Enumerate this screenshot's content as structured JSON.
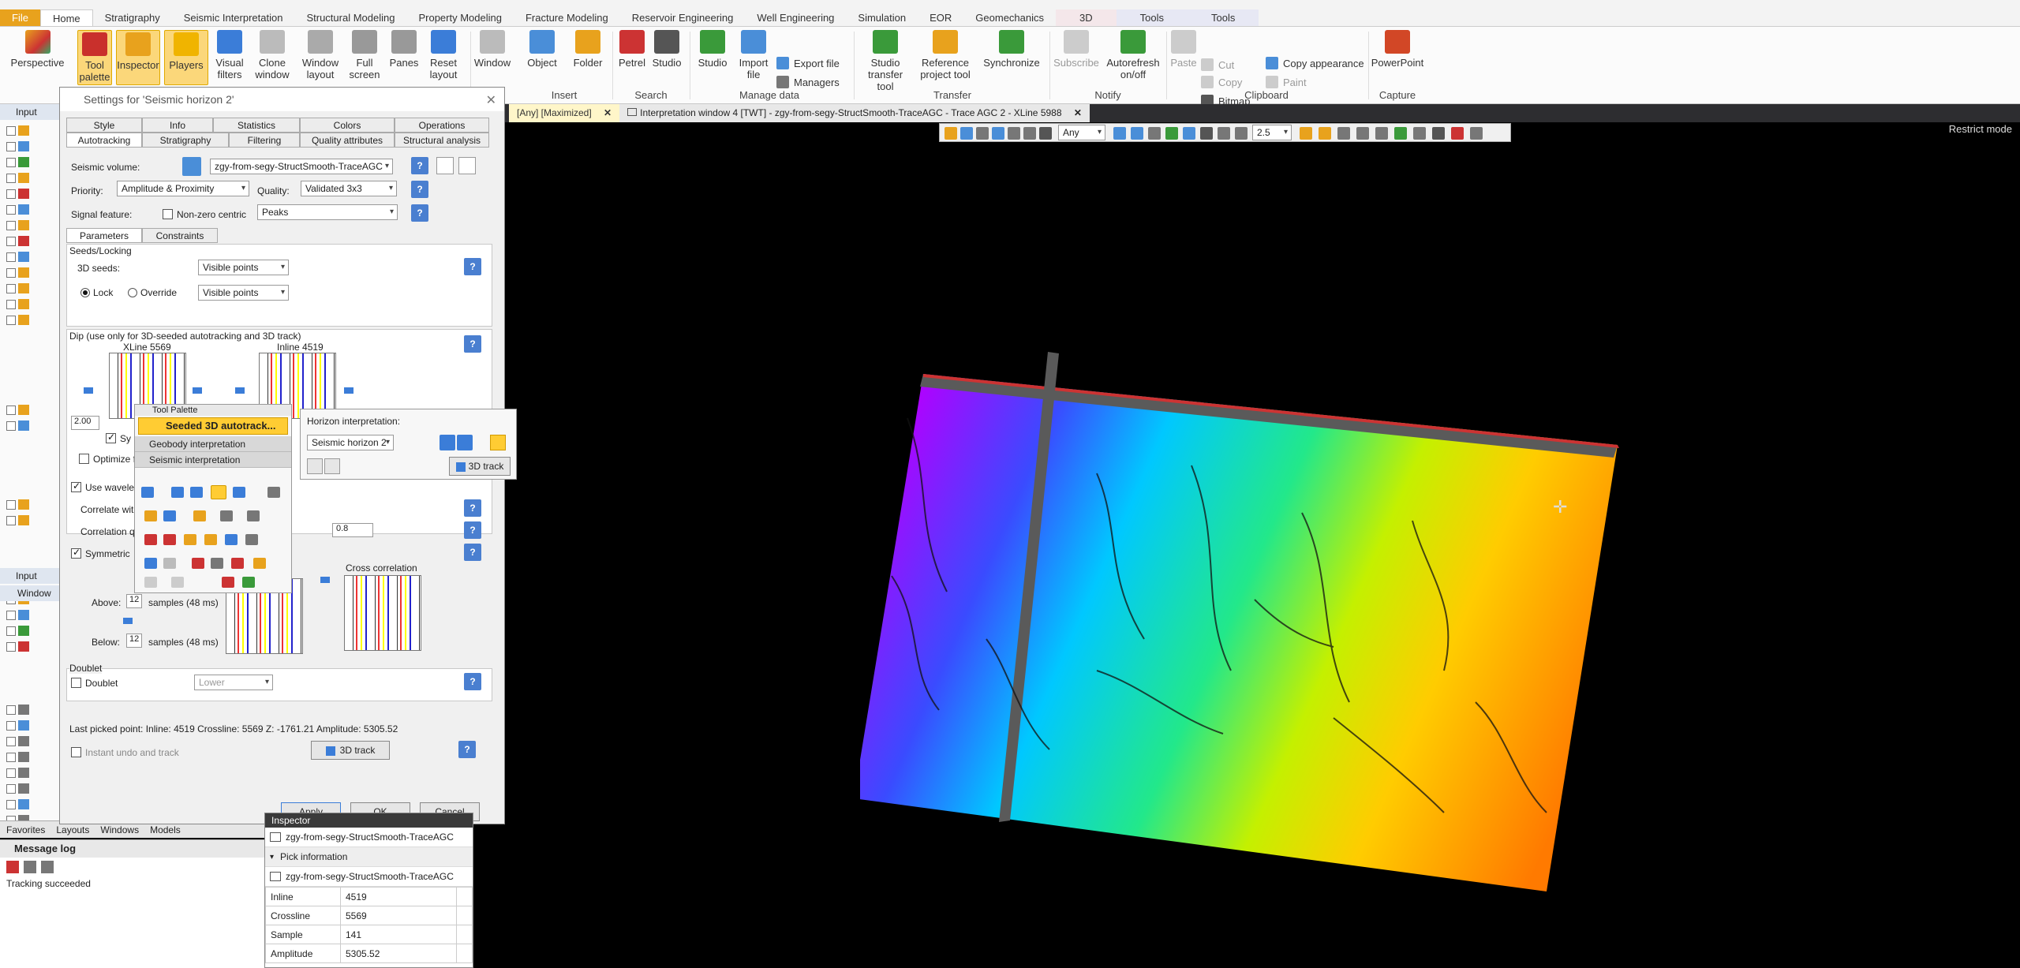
{
  "ribbon": {
    "tabs": [
      "File",
      "Home",
      "Stratigraphy",
      "Seismic Interpretation",
      "Structural Modeling",
      "Property Modeling",
      "Fracture Modeling",
      "Reservoir Engineering",
      "Well Engineering",
      "Simulation",
      "EOR",
      "Geomechanics",
      "3D",
      "Tools",
      "Tools"
    ],
    "buttons": {
      "perspective": "Perspective",
      "tool_palette": "Tool palette",
      "inspector": "Inspector",
      "players": "Players",
      "visual_filters": "Visual filters",
      "clone_window": "Clone window",
      "window_layout": "Window layout",
      "full_screen": "Full screen",
      "panes": "Panes",
      "reset_layout": "Reset layout",
      "window": "Window",
      "object": "Object",
      "folder": "Folder",
      "petrel": "Petrel",
      "studio": "Studio",
      "studio2": "Studio",
      "import_file": "Import file",
      "export_file": "Export file",
      "managers": "Managers",
      "studio_transfer": "Studio transfer tool",
      "reference_project": "Reference project tool",
      "synchronize": "Synchronize",
      "subscribe": "Subscribe",
      "autorefresh": "Autorefresh on/off",
      "paste": "Paste",
      "cut": "Cut",
      "copy": "Copy",
      "bitmap": "Bitmap",
      "copy_appearance": "Copy appearance",
      "paint": "Paint",
      "powerpoint": "PowerPoint"
    },
    "groups": {
      "insert": "Insert",
      "search": "Search",
      "manage": "Manage data",
      "transfer": "Transfer",
      "notify": "Notify",
      "clipboard": "Clipboard",
      "capture": "Capture"
    }
  },
  "doc_tabs": {
    "tab1": "[Any] [Maximized]",
    "tab2": "Interpretation window 4 [TWT] - zgy-from-segy-StructSmooth-TraceAGC - Trace AGC 2 - XLine 5988"
  },
  "view_toolbar": {
    "domain": "Any",
    "value": "2.5"
  },
  "restrict_mode": "Restrict mode",
  "left_panel": {
    "input_tab": "Input",
    "input_tab2": "Input",
    "windows_tab": "Window"
  },
  "bottom_tabs": [
    "Favorites",
    "Layouts",
    "Windows",
    "Models"
  ],
  "message_log": {
    "title": "Message log",
    "status": "Tracking succeeded"
  },
  "settings": {
    "title": "Settings for 'Seismic horizon 2'",
    "tabs_row1": [
      "Style",
      "Info",
      "Statistics",
      "Colors",
      "Operations"
    ],
    "tabs_row2": [
      "Autotracking",
      "Stratigraphy",
      "Filtering",
      "Quality attributes",
      "Structural analysis"
    ],
    "seismic_volume_label": "Seismic volume:",
    "seismic_volume_value": "zgy-from-segy-StructSmooth-TraceAGC",
    "priority_label": "Priority:",
    "priority_value": "Amplitude & Proximity",
    "quality_label": "Quality:",
    "quality_value": "Validated 3x3",
    "signal_label": "Signal feature:",
    "non_zero_centric": "Non-zero centric",
    "signal_value": "Peaks",
    "subtabs": [
      "Parameters",
      "Constraints"
    ],
    "seeds_locking": "Seeds/Locking",
    "seeds_3d_label": "3D seeds:",
    "seeds_3d_value": "Visible points",
    "lock_label": "Lock",
    "override_label": "Override",
    "override_value": "Visible points",
    "dip_label": "Dip (use only for 3D-seeded autotracking and 3D track)",
    "xline_label": "XLine 5569",
    "inline_label": "Inline 4519",
    "dip_value": "2.00",
    "sym_label": "Sy",
    "optimize_label": "Optimize fo",
    "use_wavelet": "Use wavele",
    "correlate_with": "Correlate with",
    "correlation_q": "Correlation qu",
    "correlation_value": "0.8",
    "symmetric": "Symmetric",
    "cross_correlation": "Cross correlation",
    "above_label": "Above:",
    "above_value": "12",
    "above_units": "samples (48 ms)",
    "below_label": "Below:",
    "below_value": "12",
    "below_units": "samples (48 ms)",
    "doublet_section": "Doublet",
    "doublet_label": "Doublet",
    "doublet_value": "Lower",
    "last_picked": "Last picked point: Inline: 4519 Crossline: 5569 Z: -1761.21 Amplitude: 5305.52",
    "instant_undo": "Instant undo and track",
    "track_3d": "3D track",
    "apply": "Apply",
    "ok": "OK",
    "cancel": "Cancel"
  },
  "tool_palette": {
    "title": "Tool Palette",
    "active_tool": "Seeded 3D autotrack...",
    "group1": "Geobody interpretation",
    "group2": "Seismic interpretation"
  },
  "horizon_popup": {
    "title": "Horizon interpretation:",
    "horizon": "Seismic horizon 2",
    "track_button": "3D track"
  },
  "inspector": {
    "title": "Inspector",
    "object": "zgy-from-segy-StructSmooth-TraceAGC",
    "section": "Pick information",
    "object2": "zgy-from-segy-StructSmooth-TraceAGC",
    "rows": [
      {
        "k": "Inline",
        "v": "4519"
      },
      {
        "k": "Crossline",
        "v": "5569"
      },
      {
        "k": "Sample",
        "v": "141"
      },
      {
        "k": "Amplitude",
        "v": "5305.52"
      }
    ]
  },
  "colors": {
    "accent": "#e8a21d",
    "highlight": "#fbd77a",
    "background": "#000000"
  }
}
